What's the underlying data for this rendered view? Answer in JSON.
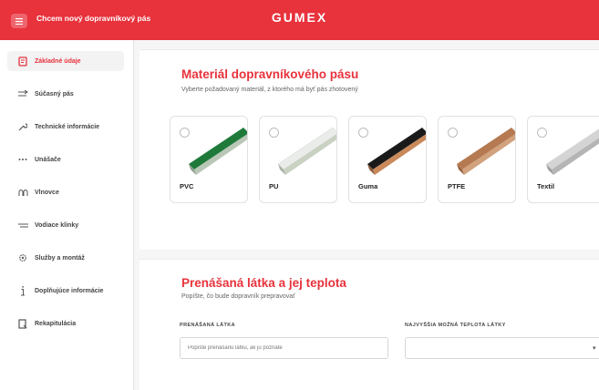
{
  "header": {
    "title": "Chcem nový dopravníkový pás",
    "logo": "GUMEX",
    "brand_color": "#e8323c"
  },
  "sidebar": {
    "items": [
      {
        "label": "Základné údaje",
        "icon": "document-icon",
        "active": true
      },
      {
        "label": "Súčasný pás",
        "icon": "arrow-right-icon",
        "active": false
      },
      {
        "label": "Technické informácie",
        "icon": "wrench-icon",
        "active": false
      },
      {
        "label": "Unášače",
        "icon": "dots-icon",
        "active": false
      },
      {
        "label": "Vlnovce",
        "icon": "wave-icon",
        "active": false
      },
      {
        "label": "Vodiace klinky",
        "icon": "guide-lines-icon",
        "active": false
      },
      {
        "label": "Služby a montáž",
        "icon": "gear-icon",
        "active": false
      },
      {
        "label": "Doplňujúce informácie",
        "icon": "info-icon",
        "active": false
      },
      {
        "label": "Rekapitulácia",
        "icon": "summary-icon",
        "active": false
      }
    ]
  },
  "material_section": {
    "title": "Materiál dopravníkového pásu",
    "subtitle": "Vyberte požadovaný materiál, z ktorého má byť pás zhotovený",
    "options": [
      {
        "label": "PVC",
        "belt_color": "#1f7a3a",
        "edge_color": "#b9c7b7"
      },
      {
        "label": "PU",
        "belt_color": "#e9ece8",
        "edge_color": "#c9d1c2"
      },
      {
        "label": "Guma",
        "belt_color": "#1a1a1a",
        "edge_color": "#c9895a"
      },
      {
        "label": "PTFE",
        "belt_color": "#b57a52",
        "edge_color": "#d2a27e"
      },
      {
        "label": "Textil",
        "belt_color": "#d4d4d4",
        "edge_color": "#b5b5b5"
      }
    ]
  },
  "transport_section": {
    "title": "Prenášaná látka a jej teplota",
    "subtitle": "Popíšte, čo bude dopravník prepravovať",
    "substance_label": "PRENÁŠANÁ LÁTKA",
    "substance_placeholder": "Popíšte prenášanú látku, ak ju poznáte",
    "temperature_label": "NAJVYŠŠIA MOŽNÁ TEPLOTA LÁTKY",
    "temperature_value": ""
  }
}
